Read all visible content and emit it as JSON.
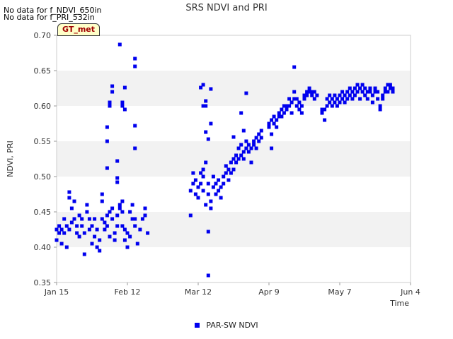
{
  "nodata_messages": [
    "No data for f_NDVI_650in",
    "No data for f_PRI_532in"
  ],
  "badge_label": "GT_met",
  "colors": {
    "series": "#0000ee",
    "band": "#f2f2f2",
    "axis": "#cccccc",
    "text": "#333333"
  },
  "chart_data": {
    "type": "scatter",
    "title": "SRS NDVI and PRI",
    "xlabel": "Time",
    "ylabel": "NDVI, PRI",
    "x_axis_type": "date",
    "xlim": [
      "2015-01-15",
      "2015-06-04"
    ],
    "ylim": [
      0.35,
      0.7
    ],
    "yticks": [
      "0.35",
      "0.40",
      "0.45",
      "0.50",
      "0.55",
      "0.60",
      "0.65",
      "0.70"
    ],
    "xtick_labels": [
      "Jan 15",
      "Feb 12",
      "Mar 12",
      "Apr 9",
      "May 7",
      "Jun 4"
    ],
    "xtick_dates": [
      "2015-01-15",
      "2015-02-12",
      "2015-03-12",
      "2015-04-09",
      "2015-05-07",
      "2015-06-04"
    ],
    "grid": "alternating horizontal bands",
    "legend_position": "bottom-center",
    "series": [
      {
        "name": "PAR-SW NDVI",
        "color": "#0000ee",
        "marker": "square",
        "points": [
          [
            "2015-01-15",
            0.425
          ],
          [
            "2015-01-15",
            0.41
          ],
          [
            "2015-01-16",
            0.43
          ],
          [
            "2015-01-16",
            0.42
          ],
          [
            "2015-01-17",
            0.405
          ],
          [
            "2015-01-17",
            0.425
          ],
          [
            "2015-01-18",
            0.44
          ],
          [
            "2015-01-18",
            0.42
          ],
          [
            "2015-01-19",
            0.43
          ],
          [
            "2015-01-19",
            0.4
          ],
          [
            "2015-01-20",
            0.478
          ],
          [
            "2015-01-20",
            0.47
          ],
          [
            "2015-01-20",
            0.425
          ],
          [
            "2015-01-21",
            0.455
          ],
          [
            "2015-01-21",
            0.435
          ],
          [
            "2015-01-22",
            0.465
          ],
          [
            "2015-01-22",
            0.44
          ],
          [
            "2015-01-23",
            0.43
          ],
          [
            "2015-01-23",
            0.42
          ],
          [
            "2015-01-24",
            0.445
          ],
          [
            "2015-01-24",
            0.415
          ],
          [
            "2015-01-25",
            0.43
          ],
          [
            "2015-01-25",
            0.44
          ],
          [
            "2015-01-26",
            0.39
          ],
          [
            "2015-01-26",
            0.42
          ],
          [
            "2015-01-27",
            0.46
          ],
          [
            "2015-01-27",
            0.45
          ],
          [
            "2015-01-28",
            0.44
          ],
          [
            "2015-01-28",
            0.425
          ],
          [
            "2015-01-29",
            0.43
          ],
          [
            "2015-01-29",
            0.405
          ],
          [
            "2015-01-30",
            0.415
          ],
          [
            "2015-01-30",
            0.44
          ],
          [
            "2015-01-31",
            0.4
          ],
          [
            "2015-01-31",
            0.425
          ],
          [
            "2015-02-01",
            0.41
          ],
          [
            "2015-02-01",
            0.395
          ],
          [
            "2015-02-02",
            0.44
          ],
          [
            "2015-02-02",
            0.475
          ],
          [
            "2015-02-02",
            0.465
          ],
          [
            "2015-02-03",
            0.425
          ],
          [
            "2015-02-03",
            0.435
          ],
          [
            "2015-02-04",
            0.43
          ],
          [
            "2015-02-04",
            0.445
          ],
          [
            "2015-02-05",
            0.45
          ],
          [
            "2015-02-05",
            0.415
          ],
          [
            "2015-02-06",
            0.44
          ],
          [
            "2015-02-06",
            0.455
          ],
          [
            "2015-02-07",
            0.42
          ],
          [
            "2015-02-07",
            0.41
          ],
          [
            "2015-02-08",
            0.445
          ],
          [
            "2015-02-08",
            0.43
          ],
          [
            "2015-02-09",
            0.46
          ],
          [
            "2015-02-09",
            0.455
          ],
          [
            "2015-02-10",
            0.45
          ],
          [
            "2015-02-10",
            0.465
          ],
          [
            "2015-02-10",
            0.43
          ],
          [
            "2015-02-11",
            0.425
          ],
          [
            "2015-02-11",
            0.41
          ],
          [
            "2015-02-12",
            0.4
          ],
          [
            "2015-02-12",
            0.42
          ],
          [
            "2015-02-13",
            0.415
          ],
          [
            "2015-02-13",
            0.45
          ],
          [
            "2015-02-14",
            0.44
          ],
          [
            "2015-02-14",
            0.46
          ],
          [
            "2015-02-15",
            0.43
          ],
          [
            "2015-02-15",
            0.44
          ],
          [
            "2015-02-16",
            0.405
          ],
          [
            "2015-02-17",
            0.425
          ],
          [
            "2015-02-18",
            0.44
          ],
          [
            "2015-02-19",
            0.455
          ],
          [
            "2015-02-19",
            0.445
          ],
          [
            "2015-02-20",
            0.42
          ],
          [
            "2015-02-05",
            0.6
          ],
          [
            "2015-02-05",
            0.605
          ],
          [
            "2015-02-06",
            0.62
          ],
          [
            "2015-02-06",
            0.628
          ],
          [
            "2015-02-04",
            0.57
          ],
          [
            "2015-02-04",
            0.55
          ],
          [
            "2015-02-04",
            0.512
          ],
          [
            "2015-02-08",
            0.522
          ],
          [
            "2015-02-08",
            0.498
          ],
          [
            "2015-02-08",
            0.492
          ],
          [
            "2015-02-09",
            0.687
          ],
          [
            "2015-02-10",
            0.6
          ],
          [
            "2015-02-10",
            0.605
          ],
          [
            "2015-02-11",
            0.626
          ],
          [
            "2015-02-11",
            0.595
          ],
          [
            "2015-02-15",
            0.572
          ],
          [
            "2015-02-15",
            0.54
          ],
          [
            "2015-02-15",
            0.667
          ],
          [
            "2015-02-15",
            0.656
          ],
          [
            "2015-03-09",
            0.445
          ],
          [
            "2015-03-09",
            0.48
          ],
          [
            "2015-03-10",
            0.505
          ],
          [
            "2015-03-10",
            0.49
          ],
          [
            "2015-03-11",
            0.475
          ],
          [
            "2015-03-11",
            0.495
          ],
          [
            "2015-03-12",
            0.485
          ],
          [
            "2015-03-12",
            0.47
          ],
          [
            "2015-03-13",
            0.505
          ],
          [
            "2015-03-13",
            0.49
          ],
          [
            "2015-03-14",
            0.48
          ],
          [
            "2015-03-14",
            0.5
          ],
          [
            "2015-03-15",
            0.46
          ],
          [
            "2015-03-15",
            0.52
          ],
          [
            "2015-03-16",
            0.49
          ],
          [
            "2015-03-16",
            0.475
          ],
          [
            "2015-03-17",
            0.455
          ],
          [
            "2015-03-17",
            0.465
          ],
          [
            "2015-03-18",
            0.485
          ],
          [
            "2015-03-18",
            0.5
          ],
          [
            "2015-03-19",
            0.49
          ],
          [
            "2015-03-19",
            0.475
          ],
          [
            "2015-03-20",
            0.48
          ],
          [
            "2015-03-20",
            0.495
          ],
          [
            "2015-03-21",
            0.485
          ],
          [
            "2015-03-21",
            0.47
          ],
          [
            "2015-03-22",
            0.5
          ],
          [
            "2015-03-22",
            0.49
          ],
          [
            "2015-03-23",
            0.505
          ],
          [
            "2015-03-23",
            0.515
          ],
          [
            "2015-03-24",
            0.495
          ],
          [
            "2015-03-24",
            0.51
          ],
          [
            "2015-03-25",
            0.52
          ],
          [
            "2015-03-25",
            0.505
          ],
          [
            "2015-03-26",
            0.525
          ],
          [
            "2015-03-26",
            0.51
          ],
          [
            "2015-03-27",
            0.52
          ],
          [
            "2015-03-27",
            0.53
          ],
          [
            "2015-03-28",
            0.525
          ],
          [
            "2015-03-28",
            0.54
          ],
          [
            "2015-03-29",
            0.53
          ],
          [
            "2015-03-29",
            0.545
          ],
          [
            "2015-03-30",
            0.535
          ],
          [
            "2015-03-30",
            0.525
          ],
          [
            "2015-03-31",
            0.54
          ],
          [
            "2015-03-31",
            0.55
          ],
          [
            "2015-04-01",
            0.535
          ],
          [
            "2015-04-01",
            0.545
          ],
          [
            "2015-04-02",
            0.52
          ],
          [
            "2015-04-02",
            0.54
          ],
          [
            "2015-04-03",
            0.55
          ],
          [
            "2015-04-03",
            0.545
          ],
          [
            "2015-04-04",
            0.555
          ],
          [
            "2015-04-04",
            0.54
          ],
          [
            "2015-04-05",
            0.56
          ],
          [
            "2015-04-05",
            0.55
          ],
          [
            "2015-04-06",
            0.565
          ],
          [
            "2015-04-06",
            0.555
          ],
          [
            "2015-03-14",
            0.63
          ],
          [
            "2015-03-14",
            0.6
          ],
          [
            "2015-03-15",
            0.607
          ],
          [
            "2015-03-15",
            0.6
          ],
          [
            "2015-03-15",
            0.563
          ],
          [
            "2015-03-17",
            0.624
          ],
          [
            "2015-03-17",
            0.575
          ],
          [
            "2015-03-16",
            0.553
          ],
          [
            "2015-03-13",
            0.626
          ],
          [
            "2015-03-14",
            0.51
          ],
          [
            "2015-03-16",
            0.422
          ],
          [
            "2015-03-16",
            0.36
          ],
          [
            "2015-03-29",
            0.59
          ],
          [
            "2015-03-31",
            0.618
          ],
          [
            "2015-03-30",
            0.565
          ],
          [
            "2015-03-26",
            0.556
          ],
          [
            "2015-04-09",
            0.575
          ],
          [
            "2015-04-09",
            0.57
          ],
          [
            "2015-04-10",
            0.56
          ],
          [
            "2015-04-10",
            0.58
          ],
          [
            "2015-04-10",
            0.54
          ],
          [
            "2015-04-11",
            0.585
          ],
          [
            "2015-04-11",
            0.575
          ],
          [
            "2015-04-12",
            0.58
          ],
          [
            "2015-04-12",
            0.57
          ],
          [
            "2015-04-13",
            0.585
          ],
          [
            "2015-04-13",
            0.59
          ],
          [
            "2015-04-14",
            0.595
          ],
          [
            "2015-04-14",
            0.585
          ],
          [
            "2015-04-15",
            0.6
          ],
          [
            "2015-04-15",
            0.59
          ],
          [
            "2015-04-16",
            0.595
          ],
          [
            "2015-04-16",
            0.6
          ],
          [
            "2015-04-17",
            0.61
          ],
          [
            "2015-04-17",
            0.6
          ],
          [
            "2015-04-18",
            0.605
          ],
          [
            "2015-04-18",
            0.59
          ],
          [
            "2015-04-19",
            0.62
          ],
          [
            "2015-04-19",
            0.61
          ],
          [
            "2015-04-19",
            0.655
          ],
          [
            "2015-04-20",
            0.6
          ],
          [
            "2015-04-20",
            0.61
          ],
          [
            "2015-04-21",
            0.605
          ],
          [
            "2015-04-21",
            0.595
          ],
          [
            "2015-04-22",
            0.6
          ],
          [
            "2015-04-22",
            0.59
          ],
          [
            "2015-04-23",
            0.61
          ],
          [
            "2015-04-23",
            0.615
          ],
          [
            "2015-04-24",
            0.62
          ],
          [
            "2015-04-24",
            0.615
          ],
          [
            "2015-04-25",
            0.625
          ],
          [
            "2015-04-25",
            0.62
          ],
          [
            "2015-04-26",
            0.615
          ],
          [
            "2015-04-26",
            0.62
          ],
          [
            "2015-04-27",
            0.61
          ],
          [
            "2015-04-27",
            0.62
          ],
          [
            "2015-04-28",
            0.615
          ],
          [
            "2015-04-30",
            0.595
          ],
          [
            "2015-04-30",
            0.59
          ],
          [
            "2015-05-01",
            0.58
          ],
          [
            "2015-05-01",
            0.595
          ],
          [
            "2015-05-02",
            0.6
          ],
          [
            "2015-05-02",
            0.61
          ],
          [
            "2015-05-03",
            0.615
          ],
          [
            "2015-05-03",
            0.605
          ],
          [
            "2015-05-04",
            0.6
          ],
          [
            "2015-05-04",
            0.61
          ],
          [
            "2015-05-05",
            0.605
          ],
          [
            "2015-05-05",
            0.615
          ],
          [
            "2015-05-06",
            0.61
          ],
          [
            "2015-05-06",
            0.6
          ],
          [
            "2015-05-07",
            0.615
          ],
          [
            "2015-05-07",
            0.605
          ],
          [
            "2015-05-08",
            0.61
          ],
          [
            "2015-05-08",
            0.62
          ],
          [
            "2015-05-09",
            0.615
          ],
          [
            "2015-05-09",
            0.605
          ],
          [
            "2015-05-10",
            0.62
          ],
          [
            "2015-05-10",
            0.61
          ],
          [
            "2015-05-11",
            0.615
          ],
          [
            "2015-05-11",
            0.625
          ],
          [
            "2015-05-12",
            0.62
          ],
          [
            "2015-05-12",
            0.61
          ],
          [
            "2015-05-13",
            0.625
          ],
          [
            "2015-05-13",
            0.615
          ],
          [
            "2015-05-14",
            0.62
          ],
          [
            "2015-05-14",
            0.63
          ],
          [
            "2015-05-15",
            0.625
          ],
          [
            "2015-05-15",
            0.61
          ],
          [
            "2015-05-16",
            0.62
          ],
          [
            "2015-05-16",
            0.63
          ],
          [
            "2015-05-17",
            0.615
          ],
          [
            "2015-05-17",
            0.625
          ],
          [
            "2015-05-18",
            0.62
          ],
          [
            "2015-05-18",
            0.61
          ],
          [
            "2015-05-19",
            0.625
          ],
          [
            "2015-05-19",
            0.62
          ],
          [
            "2015-05-20",
            0.605
          ],
          [
            "2015-05-20",
            0.615
          ],
          [
            "2015-05-21",
            0.62
          ],
          [
            "2015-05-21",
            0.625
          ],
          [
            "2015-05-22",
            0.61
          ],
          [
            "2015-05-22",
            0.62
          ],
          [
            "2015-05-23",
            0.6
          ],
          [
            "2015-05-23",
            0.595
          ],
          [
            "2015-05-24",
            0.615
          ],
          [
            "2015-05-24",
            0.61
          ],
          [
            "2015-05-25",
            0.62
          ],
          [
            "2015-05-25",
            0.625
          ],
          [
            "2015-05-26",
            0.62
          ],
          [
            "2015-05-26",
            0.63
          ],
          [
            "2015-05-27",
            0.625
          ],
          [
            "2015-05-27",
            0.63
          ],
          [
            "2015-05-28",
            0.62
          ],
          [
            "2015-05-28",
            0.625
          ]
        ]
      }
    ]
  }
}
